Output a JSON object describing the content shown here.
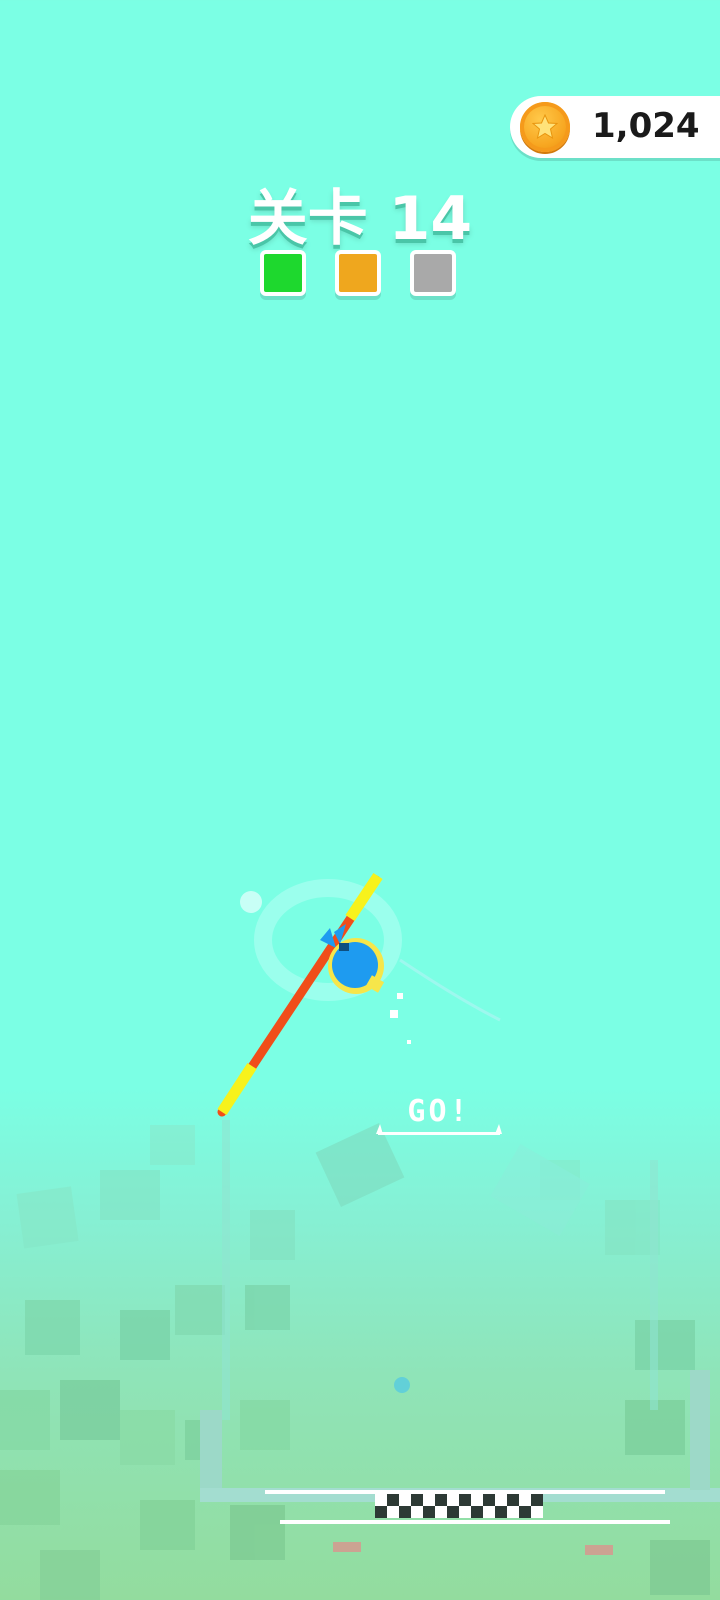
{
  "hud": {
    "coin_icon": "star-coin-icon",
    "coin_count": "1,024"
  },
  "level": {
    "title": "关卡 14",
    "stages": [
      {
        "status": "complete",
        "color": "#1ED82E"
      },
      {
        "status": "current",
        "color": "#EFA71E"
      },
      {
        "status": "locked",
        "color": "#A9A9A9"
      }
    ]
  },
  "scene": {
    "go_sign": "GO!",
    "player": "pole-vault-player",
    "pole_colors": {
      "tip": "#F7F21C",
      "shaft": "#F04E1A"
    },
    "player_color": "#1E9BF0",
    "finish_line": "checkered-finish-line"
  }
}
